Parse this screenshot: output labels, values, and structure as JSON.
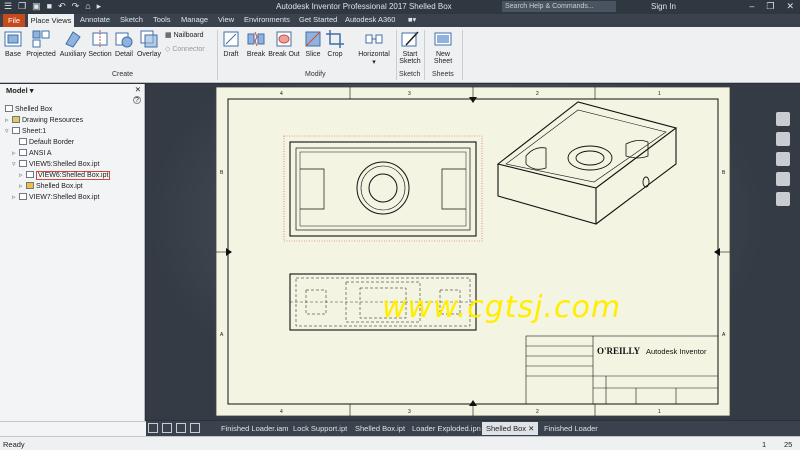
{
  "titlebar": {
    "title": "Autodesk Inventor Professional 2017   Shelled Box",
    "search_placeholder": "Search Help & Commands...",
    "sign_in": "Sign In"
  },
  "ribbon_tabs": [
    "File",
    "Place Views",
    "Annotate",
    "Sketch",
    "Tools",
    "Manage",
    "View",
    "Environments",
    "Get Started",
    "Autodesk A360"
  ],
  "ribbon": {
    "create": [
      "Base",
      "Projected",
      "Auxiliary",
      "Section",
      "Detail",
      "Overlay"
    ],
    "nailboard": "Nailboard",
    "connector": "Connector",
    "create_label": "Create",
    "modify": [
      "Draft",
      "Break",
      "Break Out",
      "Slice",
      "Crop"
    ],
    "horizontal": "Horizontal",
    "modify_label": "Modify",
    "start_sketch": "Start Sketch",
    "sketch_label": "Sketch",
    "new_sheet": "New Sheet",
    "sheets_label": "Sheets"
  },
  "browser": {
    "title": "Model",
    "items": [
      "Shelled Box",
      "Drawing Resources",
      "Sheet:1",
      "Default Border",
      "ANSI A",
      "VIEW5:Shelled Box.ipt",
      "VIEW6:Shelled Box.ipt",
      "Shelled Box.ipt",
      "VIEW7:Shelled Box.ipt"
    ]
  },
  "drawing": {
    "logo": "O'REILLY",
    "product": "Autodesk Inventor",
    "zone_numbers": [
      "4",
      "3",
      "2",
      "1"
    ],
    "zone_letters": [
      "B",
      "A"
    ]
  },
  "document_tabs": [
    "Finished Loader.iam",
    "Lock Support.ipt",
    "Shelled Box.ipt",
    "Loader Exploded.ipn",
    "Shelled Box",
    "Finished Loader"
  ],
  "status": {
    "text": "Ready",
    "num1": "1",
    "num2": "25"
  },
  "watermark": "www.cgtsj.com",
  "colors": {
    "file_tab": "#c84a1b",
    "paper": "#f4f4e2",
    "selection": "#d04a3c",
    "watermark": "#ffee00"
  }
}
